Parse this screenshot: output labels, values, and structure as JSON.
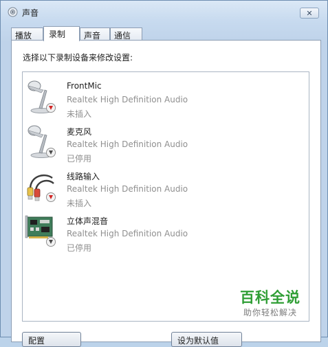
{
  "window": {
    "title": "声音",
    "icon": "speaker-icon",
    "close_glyph": "✕"
  },
  "tabs": [
    {
      "label": "播放",
      "active": false
    },
    {
      "label": "录制",
      "active": true
    },
    {
      "label": "声音",
      "active": false
    },
    {
      "label": "通信",
      "active": false
    }
  ],
  "instruction": "选择以下录制设备来修改设置:",
  "devices": [
    {
      "name": "FrontMic",
      "description": "Realtek High Definition Audio",
      "status": "未插入",
      "icon": "microphone-icon",
      "badge": "unplugged-red-down-arrow"
    },
    {
      "name": "麦克风",
      "description": "Realtek High Definition Audio",
      "status": "已停用",
      "icon": "microphone-icon",
      "badge": "disabled-gray-down-arrow"
    },
    {
      "name": "线路输入",
      "description": "Realtek High Definition Audio",
      "status": "未插入",
      "icon": "rca-cable-icon",
      "badge": "unplugged-red-down-arrow"
    },
    {
      "name": "立体声混音",
      "description": "Realtek High Definition Audio",
      "status": "已停用",
      "icon": "sound-card-icon",
      "badge": "disabled-gray-down-arrow"
    }
  ],
  "watermark": {
    "title": "百科全说",
    "subtitle": "助你轻松解决",
    "color": "#2f9e35"
  },
  "buttons": {
    "configure_label": "配置",
    "set_default_label": "设为默认值"
  }
}
